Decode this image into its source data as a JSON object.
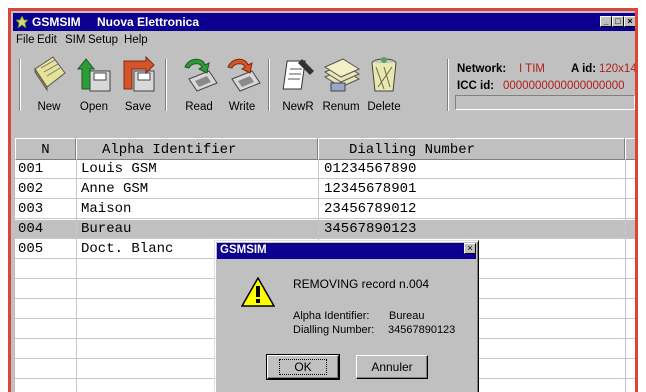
{
  "window": {
    "app_name": "GSMSIM",
    "subtitle": "Nuova Elettronica",
    "minimize": "_",
    "maximize": "□",
    "close": "×"
  },
  "menu": [
    "File",
    "Edit",
    "SIM",
    "Setup",
    "Help"
  ],
  "toolbar": [
    {
      "label": "New",
      "icon": "notepad-icon"
    },
    {
      "label": "Open",
      "icon": "open-arrow-icon"
    },
    {
      "label": "Save",
      "icon": "save-arrow-icon"
    },
    {
      "label": "Read",
      "icon": "read-sim-icon"
    },
    {
      "label": "Write",
      "icon": "write-sim-icon"
    },
    {
      "label": "NewR",
      "icon": "new-record-icon"
    },
    {
      "label": "Renum",
      "icon": "renumber-icon"
    },
    {
      "label": "Delete",
      "icon": "trash-icon"
    }
  ],
  "status": {
    "network_label": "Network:",
    "network_value": "I TIM",
    "aid_label": "A id:",
    "aid_value": "120x14",
    "icc_label": "ICC id:",
    "icc_value": "0000000000000000000"
  },
  "table": {
    "columns": [
      "N",
      "Alpha Identifier",
      "Dialling Number"
    ],
    "rows": [
      {
        "n": "001",
        "alpha": "Louis GSM",
        "number": "01234567890"
      },
      {
        "n": "002",
        "alpha": "Anne GSM",
        "number": "12345678901"
      },
      {
        "n": "003",
        "alpha": "Maison",
        "number": "23456789012"
      },
      {
        "n": "004",
        "alpha": "Bureau",
        "number": "34567890123"
      },
      {
        "n": "005",
        "alpha": "Doct. Blanc",
        "number": ""
      }
    ],
    "selected_row": 3
  },
  "dialog": {
    "title": "GSMSIM",
    "close": "×",
    "message": "REMOVING record n.004",
    "alpha_label": "Alpha Identifier:",
    "alpha_value": "Bureau",
    "number_label": "Dialling Number:",
    "number_value": "34567890123",
    "ok_label": "OK",
    "cancel_label": "Annuler"
  },
  "colors": {
    "titlebar": "#0d0090",
    "frame_border": "#d8453a",
    "status_value": "#b22018"
  }
}
